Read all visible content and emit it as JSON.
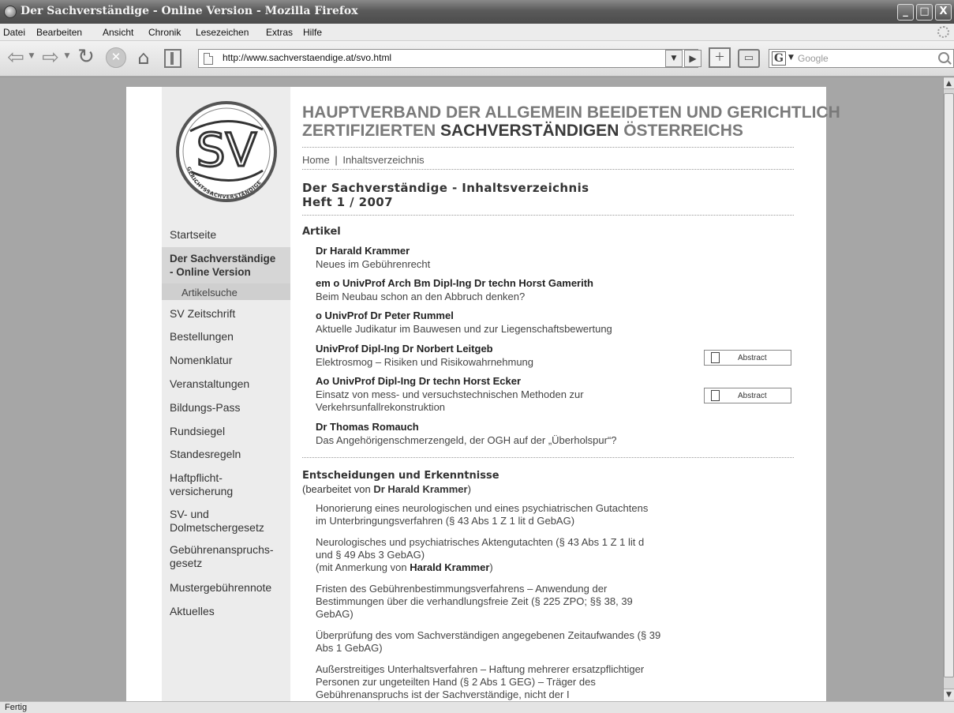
{
  "window": {
    "title": "Der Sachverständige - Online Version - Mozilla Firefox",
    "controls": [
      "_",
      "□",
      "X"
    ]
  },
  "menu": [
    "Datei",
    "Bearbeiten",
    "Ansicht",
    "Chronik",
    "Lesezeichen",
    "Extras",
    "Hilfe"
  ],
  "toolbar": {
    "url": "http://www.sachverstaendige.at/svo.html",
    "search_engine": "G",
    "search_placeholder": "Google"
  },
  "header": {
    "line1": "HAUPTVERBAND DER ALLGEMEIN BEEIDETEN UND GERICHTLICH",
    "line2_prefix": "ZERTIFIZIERTEN ",
    "line2_strong": "SACHVERSTÄNDIGEN",
    "line2_suffix": " ÖSTERREICHS"
  },
  "logo": {
    "letters": "SV",
    "ring_text": "GERICHTSSACHVERSTÄNDIGE"
  },
  "breadcrumb": {
    "home": "Home",
    "separator": "|",
    "current": "Inhaltsverzeichnis"
  },
  "page_title": {
    "line1": "Der Sachverständige - Inhaltsverzeichnis",
    "line2": "Heft 1 / 2007"
  },
  "sidebar": {
    "items": [
      {
        "label": "Startseite"
      },
      {
        "label": "Der Sachverständige - Online Version",
        "line1": "Der Sachverständige",
        "line2": "- Online Version"
      },
      {
        "label": "Artikelsuche"
      },
      {
        "label": "SV Zeitschrift"
      },
      {
        "label": "Bestellungen"
      },
      {
        "label": "Nomenklatur"
      },
      {
        "label": "Veranstaltungen"
      },
      {
        "label": "Bildungs-Pass"
      },
      {
        "label": "Rundsiegel"
      },
      {
        "label": "Standesregeln"
      },
      {
        "label": "Haftpflicht-versicherung",
        "line1": "Haftpflicht-",
        "line2": "versicherung"
      },
      {
        "label": "SV- und Dolmetschergesetz",
        "line1": "SV- und",
        "line2": "Dolmetschergesetz"
      },
      {
        "label": "Gebührenanspruchs-gesetz",
        "line1": "Gebührenanspruchs-",
        "line2": "gesetz"
      },
      {
        "label": "Mustergebührennote"
      },
      {
        "label": "Aktuelles"
      }
    ]
  },
  "articles": {
    "heading": "Artikel",
    "abstract_label": "Abstract",
    "items": [
      {
        "author": "Dr Harald Krammer",
        "title": "Neues im Gebührenrecht"
      },
      {
        "author": "em o UnivProf Arch Bm Dipl-Ing Dr techn Horst Gamerith",
        "title": "Beim Neubau schon an den Abbruch denken?"
      },
      {
        "author": "o UnivProf Dr Peter Rummel",
        "title": "Aktuelle Judikatur im Bauwesen und zur Liegenschaftsbewertung"
      },
      {
        "author": "UnivProf Dipl-Ing Dr Norbert Leitgeb",
        "title": "Elektrosmog – Risiken und Risikowahrnehmung"
      },
      {
        "author": "Ao UnivProf Dipl-Ing Dr techn Horst Ecker",
        "title_line1": "Einsatz von mess- und versuchstechnischen Methoden zur",
        "title_line2": "Verkehrsunfallrekonstruktion"
      },
      {
        "author": "Dr Thomas Romauch",
        "title": "Das Angehörigenschmerzengeld, der OGH auf der „Überholspur“?"
      }
    ]
  },
  "decisions": {
    "heading": "Entscheidungen und Erkenntnisse",
    "editor_prefix": "(bearbeitet von ",
    "editor_name": "Dr Harald Krammer",
    "editor_suffix": ")",
    "items": [
      {
        "lines": [
          "Honorierung eines neurologischen und eines psychiatrischen Gutachtens",
          "im Unterbringungsverfahren (§ 43 Abs 1 Z 1 lit d GebAG)"
        ]
      },
      {
        "lines": [
          "Neurologisches und psychiatrisches Aktengutachten (§ 43 Abs 1 Z 1 lit d",
          "und § 49 Abs 3 GebAG)"
        ],
        "note_prefix": "(mit Anmerkung von ",
        "note_name": "Harald Krammer",
        "note_suffix": ")"
      },
      {
        "lines": [
          "Fristen des Gebührenbestimmungsverfahrens – Anwendung der",
          "Bestimmungen über die verhandlungsfreie Zeit (§ 225 ZPO; §§ 38, 39",
          "GebAG)"
        ]
      },
      {
        "lines": [
          "Überprüfung des vom Sachverständigen angegebenen Zeitaufwandes (§ 39",
          "Abs 1 GebAG)"
        ]
      },
      {
        "lines": [
          "Außerstreitiges Unterhaltsverfahren – Haftung mehrerer ersatzpflichtiger",
          "Personen zur ungeteilten Hand (§ 2 Abs 1 GEG) – Träger des",
          "Gebührenanspruchs ist der Sachverständige, nicht der I"
        ]
      }
    ]
  },
  "status": "Fertig"
}
